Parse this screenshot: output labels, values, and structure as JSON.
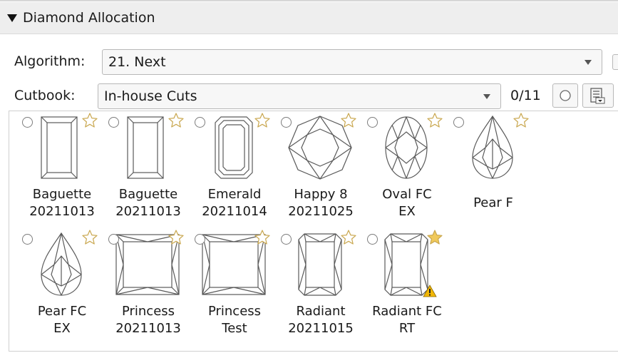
{
  "section": {
    "title": "Diamond Allocation"
  },
  "algorithm": {
    "label": "Algorithm:",
    "value": "21. Next"
  },
  "cutbook": {
    "label": "Cutbook:",
    "value": "In-house Cuts",
    "count": "0/11"
  },
  "colors": {
    "header_bg": "#eeeeee",
    "star_filled": "#f0c95b",
    "star_outline": "#c9a74f",
    "warning": "#f2b705",
    "shape_stroke": "#5a5a5a"
  },
  "cuts": [
    {
      "line1": "Baguette",
      "line2": "20211013",
      "shape": "baguette",
      "favorite": false,
      "warning": false
    },
    {
      "line1": "Baguette",
      "line2": "20211013",
      "shape": "baguette",
      "favorite": false,
      "warning": false
    },
    {
      "line1": "Emerald",
      "line2": "20211014",
      "shape": "emerald",
      "favorite": false,
      "warning": false
    },
    {
      "line1": "Happy 8",
      "line2": "20211025",
      "shape": "octagon",
      "favorite": false,
      "warning": false
    },
    {
      "line1": "Oval FC",
      "line2": "EX",
      "shape": "oval",
      "favorite": false,
      "warning": false
    },
    {
      "line1": "Pear F",
      "line2": "",
      "shape": "pear",
      "favorite": false,
      "warning": false
    },
    {
      "line1": "Pear FC",
      "line2": "EX",
      "shape": "pear-fc",
      "favorite": false,
      "warning": false
    },
    {
      "line1": "Princess",
      "line2": "20211013",
      "shape": "princess",
      "favorite": false,
      "warning": false
    },
    {
      "line1": "Princess",
      "line2": "Test",
      "shape": "princess",
      "favorite": false,
      "warning": false
    },
    {
      "line1": "Radiant",
      "line2": "20211015",
      "shape": "radiant",
      "favorite": false,
      "warning": false
    },
    {
      "line1": "Radiant FC",
      "line2": "RT",
      "shape": "radiant",
      "favorite": true,
      "warning": true
    }
  ]
}
